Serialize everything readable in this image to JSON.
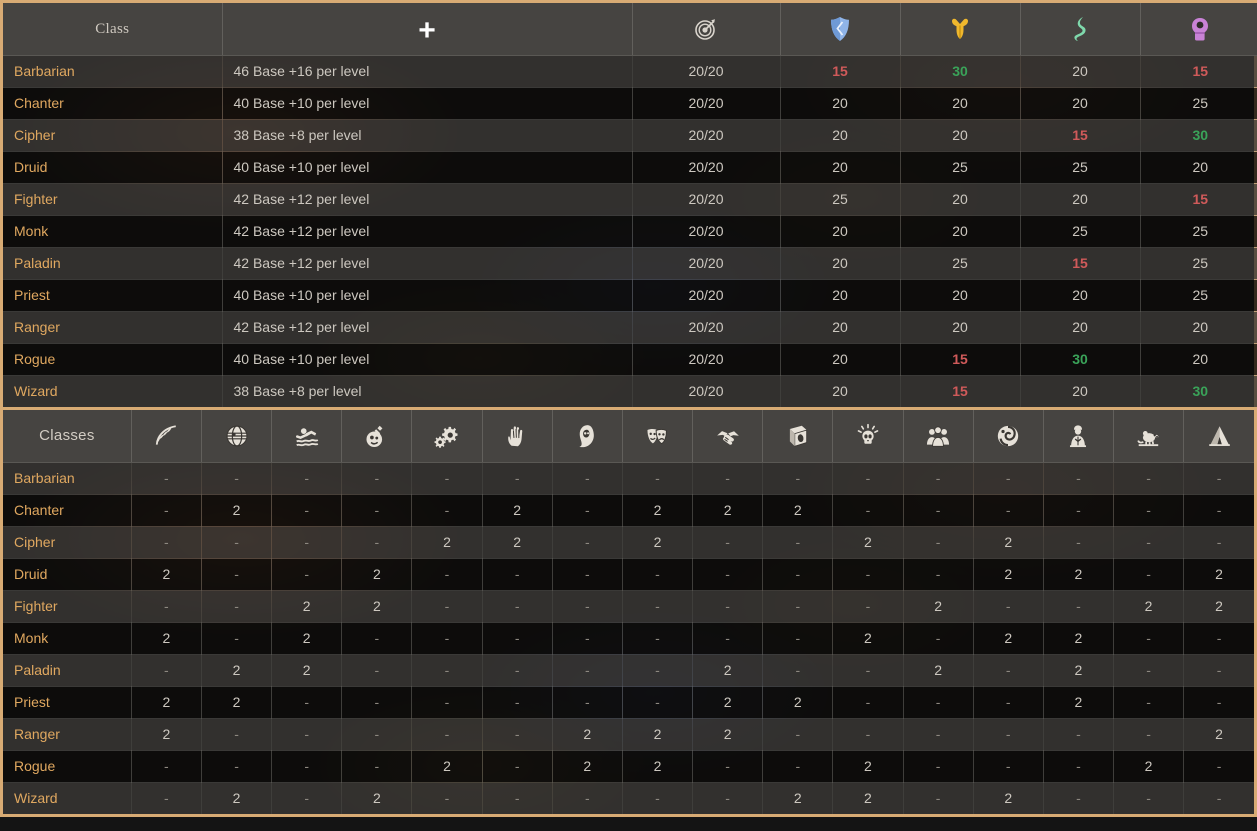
{
  "theme": {
    "border_accent": "#d8ab74",
    "header_bg": "#464441",
    "class_name_color": "#e0a860",
    "value_low_color": "#d05a5a",
    "value_high_color": "#3aa359",
    "text_color": "#cdc8c0"
  },
  "table_classes": {
    "headers": [
      {
        "label": "Class",
        "icon": null,
        "name": "class"
      },
      {
        "label": "+",
        "icon": "plus-icon",
        "name": "health"
      },
      {
        "label": "",
        "icon": "accuracy-target-icon",
        "name": "accuracy"
      },
      {
        "label": "",
        "icon": "shield-deflection-icon",
        "name": "deflection"
      },
      {
        "label": "",
        "icon": "fortitude-muscle-icon",
        "name": "fortitude"
      },
      {
        "label": "",
        "icon": "reflex-agility-icon",
        "name": "reflex"
      },
      {
        "label": "",
        "icon": "will-head-icon",
        "name": "will"
      }
    ],
    "rows": [
      {
        "class": "Barbarian",
        "health": "46 Base +16 per level",
        "accuracy": "20/20",
        "deflection": "15",
        "fortitude": "30",
        "reflex": "20",
        "will": "15"
      },
      {
        "class": "Chanter",
        "health": "40 Base +10 per level",
        "accuracy": "20/20",
        "deflection": "20",
        "fortitude": "20",
        "reflex": "20",
        "will": "25"
      },
      {
        "class": "Cipher",
        "health": "38 Base +8 per level",
        "accuracy": "20/20",
        "deflection": "20",
        "fortitude": "20",
        "reflex": "15",
        "will": "30"
      },
      {
        "class": "Druid",
        "health": "40 Base +10 per level",
        "accuracy": "20/20",
        "deflection": "20",
        "fortitude": "25",
        "reflex": "25",
        "will": "20"
      },
      {
        "class": "Fighter",
        "health": "42 Base +12 per level",
        "accuracy": "20/20",
        "deflection": "25",
        "fortitude": "20",
        "reflex": "20",
        "will": "15"
      },
      {
        "class": "Monk",
        "health": "42 Base +12 per level",
        "accuracy": "20/20",
        "deflection": "20",
        "fortitude": "20",
        "reflex": "25",
        "will": "25"
      },
      {
        "class": "Paladin",
        "health": "42 Base +12 per level",
        "accuracy": "20/20",
        "deflection": "20",
        "fortitude": "25",
        "reflex": "15",
        "will": "25"
      },
      {
        "class": "Priest",
        "health": "40 Base +10 per level",
        "accuracy": "20/20",
        "deflection": "20",
        "fortitude": "20",
        "reflex": "20",
        "will": "25"
      },
      {
        "class": "Ranger",
        "health": "42 Base +12 per level",
        "accuracy": "20/20",
        "deflection": "20",
        "fortitude": "20",
        "reflex": "20",
        "will": "20"
      },
      {
        "class": "Rogue",
        "health": "40 Base +10 per level",
        "accuracy": "20/20",
        "deflection": "20",
        "fortitude": "15",
        "reflex": "30",
        "will": "20"
      },
      {
        "class": "Wizard",
        "health": "38 Base +8 per level",
        "accuracy": "20/20",
        "deflection": "20",
        "fortitude": "15",
        "reflex": "20",
        "will": "30"
      }
    ]
  },
  "table_skills": {
    "corner_label": "Classes",
    "headers": [
      {
        "name": "survival",
        "icon": "leaf-branch-icon"
      },
      {
        "name": "lore",
        "icon": "globe-sphere-icon"
      },
      {
        "name": "athletics",
        "icon": "swimmer-icon"
      },
      {
        "name": "alchemy",
        "icon": "potion-flask-icon"
      },
      {
        "name": "mechanics",
        "icon": "gears-icon"
      },
      {
        "name": "sleight",
        "icon": "hand-icon"
      },
      {
        "name": "stealth",
        "icon": "hooded-figure-icon"
      },
      {
        "name": "acting",
        "icon": "theater-masks-icon"
      },
      {
        "name": "diplomacy",
        "icon": "handshake-icon"
      },
      {
        "name": "history",
        "icon": "book-icon"
      },
      {
        "name": "insight",
        "icon": "skull-idea-icon"
      },
      {
        "name": "streetwise",
        "icon": "crowd-group-icon"
      },
      {
        "name": "arcana",
        "icon": "spiral-swirl-icon"
      },
      {
        "name": "religion",
        "icon": "robed-figure-icon"
      },
      {
        "name": "bestiary",
        "icon": "rat-icon"
      },
      {
        "name": "camping",
        "icon": "tent-icon"
      }
    ],
    "rows": [
      {
        "class": "Barbarian",
        "values": [
          "-",
          "-",
          "-",
          "-",
          "-",
          "-",
          "-",
          "-",
          "-",
          "-",
          "-",
          "-",
          "-",
          "-",
          "-",
          "-"
        ]
      },
      {
        "class": "Chanter",
        "values": [
          "-",
          "2",
          "-",
          "-",
          "-",
          "2",
          "-",
          "2",
          "2",
          "2",
          "-",
          "-",
          "-",
          "-",
          "-",
          "-"
        ]
      },
      {
        "class": "Cipher",
        "values": [
          "-",
          "-",
          "-",
          "-",
          "2",
          "2",
          "-",
          "2",
          "-",
          "-",
          "2",
          "-",
          "2",
          "-",
          "-",
          "-"
        ]
      },
      {
        "class": "Druid",
        "values": [
          "2",
          "-",
          "-",
          "2",
          "-",
          "-",
          "-",
          "-",
          "-",
          "-",
          "-",
          "-",
          "2",
          "2",
          "-",
          "2"
        ]
      },
      {
        "class": "Fighter",
        "values": [
          "-",
          "-",
          "2",
          "2",
          "-",
          "-",
          "-",
          "-",
          "-",
          "-",
          "-",
          "2",
          "-",
          "-",
          "2",
          "2"
        ]
      },
      {
        "class": "Monk",
        "values": [
          "2",
          "-",
          "2",
          "-",
          "-",
          "-",
          "-",
          "-",
          "-",
          "-",
          "2",
          "-",
          "2",
          "2",
          "-",
          "-"
        ]
      },
      {
        "class": "Paladin",
        "values": [
          "-",
          "2",
          "2",
          "-",
          "-",
          "-",
          "-",
          "-",
          "2",
          "-",
          "-",
          "2",
          "-",
          "2",
          "-",
          "-"
        ]
      },
      {
        "class": "Priest",
        "values": [
          "2",
          "2",
          "-",
          "-",
          "-",
          "-",
          "-",
          "-",
          "2",
          "2",
          "-",
          "-",
          "-",
          "2",
          "-",
          "-"
        ]
      },
      {
        "class": "Ranger",
        "values": [
          "2",
          "-",
          "-",
          "-",
          "-",
          "-",
          "2",
          "2",
          "2",
          "-",
          "-",
          "-",
          "-",
          "-",
          "-",
          "2"
        ]
      },
      {
        "class": "Rogue",
        "values": [
          "-",
          "-",
          "-",
          "-",
          "2",
          "-",
          "2",
          "2",
          "-",
          "-",
          "2",
          "-",
          "-",
          "-",
          "2",
          "-"
        ]
      },
      {
        "class": "Wizard",
        "values": [
          "-",
          "2",
          "-",
          "2",
          "-",
          "-",
          "-",
          "-",
          "-",
          "2",
          "2",
          "-",
          "2",
          "-",
          "-",
          "-"
        ]
      }
    ]
  }
}
